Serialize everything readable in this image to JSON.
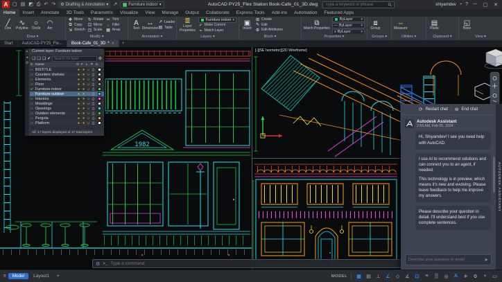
{
  "icons": {
    "logo": "A",
    "new": "▢",
    "open": "▤",
    "save": "◩",
    "plot": "⎙",
    "undo": "↶",
    "redo": "↷",
    "share": "↗",
    "cloud": "△",
    "dropdown": "▾",
    "search": "⚲",
    "help": "?",
    "bell": "◔",
    "minimize": "─",
    "maximize": "▢",
    "close": "✕",
    "gear": "⚙",
    "hamburger": "≡",
    "plus": "+",
    "prompt": "&gt;_",
    "line": "╱",
    "polyline": "∿",
    "circle": "○",
    "arc": "◠",
    "move": "✥",
    "rotate": "↻",
    "trim": "✂",
    "copy": "⧉",
    "mirror": "◫",
    "fillet": "◞",
    "stretch": "⇲",
    "scale": "◳",
    "array": "▦",
    "text": "A",
    "dimension": "↔",
    "leader": "↗",
    "table": "▤",
    "layerprops": "≣",
    "makecurrent": "✔",
    "matchlayer": "≈",
    "insert": "▣",
    "create": "⊞",
    "edit": "✎",
    "editattr": "⚙",
    "matchprops": "⧉",
    "group": "⧈",
    "measure": "⇔",
    "paste": "▤",
    "base": "◱",
    "bulb": "●",
    "sun": "☀",
    "lock": "∪",
    "printer": "⎙",
    "restart": "⟳",
    "endchat": "⊗",
    "send": "➤",
    "newlayer": "❏",
    "dellayer": "❏",
    "statuslayer": "▱"
  },
  "titlebar": {
    "doc_title": "AutoCAD PY25_Flex Station Book-Cafe_01_3D.dwg",
    "workspace": "Drafting & Annotation",
    "qat_layer": "Furniture indoor",
    "search_placeholder": "Type a keyword or phrase",
    "account": "shiyamdev"
  },
  "ribbon": {
    "tabs": [
      "Home",
      "Insert",
      "Annotate",
      "3D Tools",
      "Parametric",
      "Visualize",
      "View",
      "Manage",
      "Output",
      "Collaborate",
      "Express Tools",
      "Add-ins",
      "Automation",
      "Featured Apps"
    ],
    "active_tab": "Home",
    "draw": {
      "label": "Draw",
      "b": [
        "Line",
        "Polyline",
        "Circle",
        "Arc"
      ]
    },
    "modify": {
      "label": "Modify",
      "b": [
        "Move",
        "Copy",
        "Stretch",
        "Rotate",
        "Mirror",
        "Scale",
        "Trim",
        "Fillet",
        "Array"
      ]
    },
    "annotation": {
      "label": "Annotation",
      "b": [
        "Text",
        "Dimension",
        "Leader",
        "Table"
      ]
    },
    "layers": {
      "label": "Layers",
      "combo": "Furniture indoor",
      "b": [
        "Layer Properties",
        "Make Current",
        "Match Layer"
      ]
    },
    "block": {
      "label": "Block",
      "b": [
        "Insert",
        "Create",
        "Edit",
        "Edit Attributes"
      ]
    },
    "properties": {
      "label": "Properties",
      "b": [
        "Match Properties"
      ],
      "combos": [
        "ByLayer",
        "ByLayer",
        "ByLayer"
      ]
    },
    "groups": {
      "label": "Groups",
      "b": [
        "Group"
      ]
    },
    "utilities": {
      "label": "Utilities",
      "b": [
        "Measure"
      ]
    },
    "clipboard": {
      "label": "Clipboard",
      "b": [
        "Paste"
      ]
    },
    "view": {
      "label": "View",
      "b": [
        "Base"
      ]
    }
  },
  "file_tabs": {
    "start": "Start",
    "doc1": "AutoCAD-PY25_Fle...",
    "doc2": "Book-Cafe_01_3D",
    "modified": "*",
    "new_tab": "+"
  },
  "layer_palette": {
    "title": "Current layer: Furniture indoor",
    "search_placeholder": "Search for layer",
    "columns": [
      "S",
      "Name",
      "O",
      "F",
      "L",
      "P",
      "C"
    ],
    "layers": [
      {
        "name": "BISTITLE",
        "color": "#ffffff"
      },
      {
        "name": "Counters shelves",
        "color": "#bfbfbf"
      },
      {
        "name": "Elements",
        "color": "#ffffff"
      },
      {
        "name": "Floor",
        "color": "#9c9c9c"
      },
      {
        "name": "Furniture indoor",
        "color": "#19e84b"
      },
      {
        "name": "Furniture outdoor",
        "color": "#27e0e6"
      },
      {
        "name": "Interiors",
        "color": "#ff40ff"
      },
      {
        "name": "Mouldings",
        "color": "#e8e8e8"
      },
      {
        "name": "Openings",
        "color": "#27e0e6"
      },
      {
        "name": "Outdoor elements",
        "color": "#19e84b"
      },
      {
        "name": "Pergola",
        "color": "#ff9f1a"
      },
      {
        "name": "Platform",
        "color": "#ffffff"
      }
    ],
    "status": "All: 17 layers displayed of 17 total layers"
  },
  "viewport": {
    "right_label": "[-][SE Isometric][2D Wireframe]",
    "pediment_text": "1982"
  },
  "assistant": {
    "restart": "Restart chat",
    "end": "End chat",
    "bot": "Autodesk Assistant",
    "time": "2:55 AM, Feb 05, 2024",
    "bubbles": [
      {
        "p1": "Hi, Shiyamdev! I see you need help with AutoCAD."
      },
      {
        "p1": "I use AI to recommend solutions and can connect you to an agent, if needed.",
        "p2": "This technology is in preview, which means it's new and evolving. Please leave feedback to help me improve my answers."
      },
      {
        "p1": "Please describe your question in detail. I'll understand best if you use complete sentences."
      }
    ],
    "input_placeholder": "Describe your question in detail",
    "side_label": "AUTODESK ASSISTANT"
  },
  "command_line": {
    "placeholder": "Type a command"
  },
  "statusbar": {
    "model_tab": "Model",
    "layout_tab": "Layout1",
    "new_layout": "+",
    "space_label": "MODEL",
    "icons": [
      {
        "g": "▦"
      },
      {
        "g": "▤"
      },
      {
        "g": "⊥"
      },
      {
        "g": "∠"
      },
      {
        "g": "◇"
      },
      {
        "g": "∡"
      },
      {
        "g": "⊡"
      },
      {
        "g": "≡"
      },
      {
        "g": "▒"
      },
      {
        "g": "◎"
      },
      {
        "g": "A"
      },
      {
        "g": "✳"
      },
      {
        "g": "⚙"
      },
      {
        "g": "+"
      },
      {
        "g": "▭"
      }
    ]
  }
}
